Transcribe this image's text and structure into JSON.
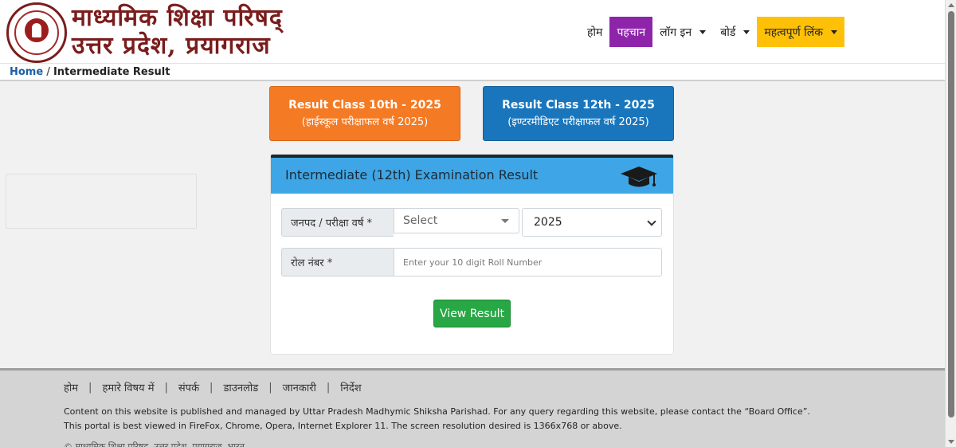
{
  "header": {
    "title_line1": "माध्यमिक शिक्षा परिषद्",
    "title_line2": "उत्तर प्रदेश, प्रयागराज"
  },
  "nav": {
    "items": [
      {
        "label": "होम",
        "active": false,
        "dropdown": false
      },
      {
        "label": "पहचान",
        "active": true,
        "dropdown": false
      },
      {
        "label": "लॉग इन",
        "active": false,
        "dropdown": true
      },
      {
        "label": "बोर्ड",
        "active": false,
        "dropdown": true
      },
      {
        "label": "महत्वपूर्ण लिंक",
        "active": false,
        "dropdown": true,
        "highlight": true
      }
    ],
    "active_color": "#8e24aa",
    "highlight_color": "#ffc107"
  },
  "breadcrumb": {
    "home": "Home",
    "separator": "/",
    "current": "Intermediate Result"
  },
  "class_buttons": {
    "class10": {
      "title": "Result Class 10th - 2025",
      "subtitle": "(हाईस्कूल परीक्षाफल वर्ष 2025)",
      "color": "#f47a24"
    },
    "class12": {
      "title": "Result Class 12th - 2025",
      "subtitle": "(इण्टरमीडिएट परीक्षाफल वर्ष 2025)",
      "color": "#1976bd"
    }
  },
  "form": {
    "title": "Intermediate (12th) Examination Result",
    "district_label": "जनपद / परीक्षा वर्ष *",
    "district_select": "Select",
    "year_select": "2025",
    "roll_label": "रोल नंबर *",
    "roll_placeholder": "Enter your 10 digit Roll Number",
    "submit_label": "View Result",
    "header_color": "#3ea6e6",
    "submit_color": "#28a745"
  },
  "footer": {
    "links": [
      "होम",
      "हमारे विषय में",
      "संपर्क",
      "डाउनलोड",
      "जानकारी",
      "निर्देश"
    ],
    "separator": "|",
    "text1": "Content on this website is published and managed by Uttar Pradesh Madhymic Shiksha Parishad. For any query regarding this website, please contact the “Board Office”.",
    "text2": "This portal is best viewed in FireFox, Chrome, Opera, Internet Explorer 11. The screen resolution desired is 1366x768 or above.",
    "copyright": "© माध्यमिक शिक्षा परिषद, उत्तर प्रदेश, प्रयागराज, भारत"
  }
}
